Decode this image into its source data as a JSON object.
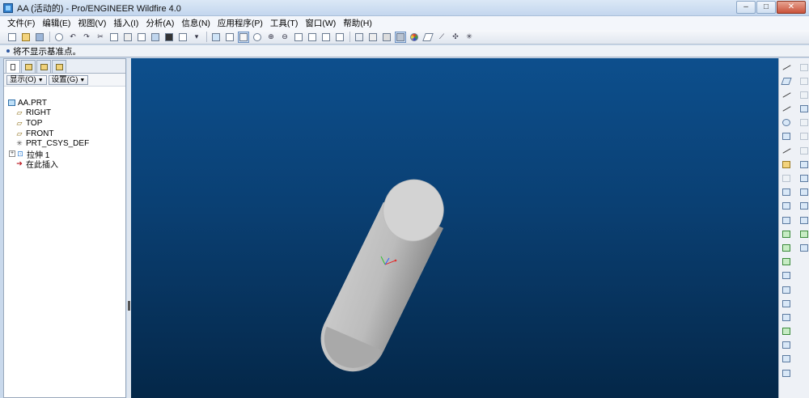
{
  "window": {
    "title": "AA (活动的) - Pro/ENGINEER Wildfire 4.0",
    "minimize_label": "–",
    "maximize_label": "□",
    "close_label": "✕"
  },
  "menu": {
    "items": [
      {
        "label": "文件(F)"
      },
      {
        "label": "编辑(E)"
      },
      {
        "label": "视图(V)"
      },
      {
        "label": "插入(I)"
      },
      {
        "label": "分析(A)"
      },
      {
        "label": "信息(N)"
      },
      {
        "label": "应用程序(P)"
      },
      {
        "label": "工具(T)"
      },
      {
        "label": "窗口(W)"
      },
      {
        "label": "帮助(H)"
      }
    ]
  },
  "message": {
    "text": "将不显示基准点。"
  },
  "model_tree": {
    "show_button": "显示(O)",
    "settings_button": "设置(G)",
    "items": [
      {
        "label": "AA.PRT",
        "icon": "part-icon",
        "expander": ""
      },
      {
        "label": "RIGHT",
        "icon": "datum-plane-icon",
        "expander": ""
      },
      {
        "label": "TOP",
        "icon": "datum-plane-icon",
        "expander": ""
      },
      {
        "label": "FRONT",
        "icon": "datum-plane-icon",
        "expander": ""
      },
      {
        "label": "PRT_CSYS_DEF",
        "icon": "coordinate-system-icon",
        "expander": ""
      },
      {
        "label": "拉伸 1",
        "icon": "extrude-icon",
        "expander": "+"
      },
      {
        "label": "在此插入",
        "icon": "insert-here-arrow-icon",
        "expander": ""
      }
    ]
  },
  "colors": {
    "viewport_top": "#0d4f8d",
    "viewport_bottom": "#042748",
    "model_fill": "#c2c2c2"
  }
}
